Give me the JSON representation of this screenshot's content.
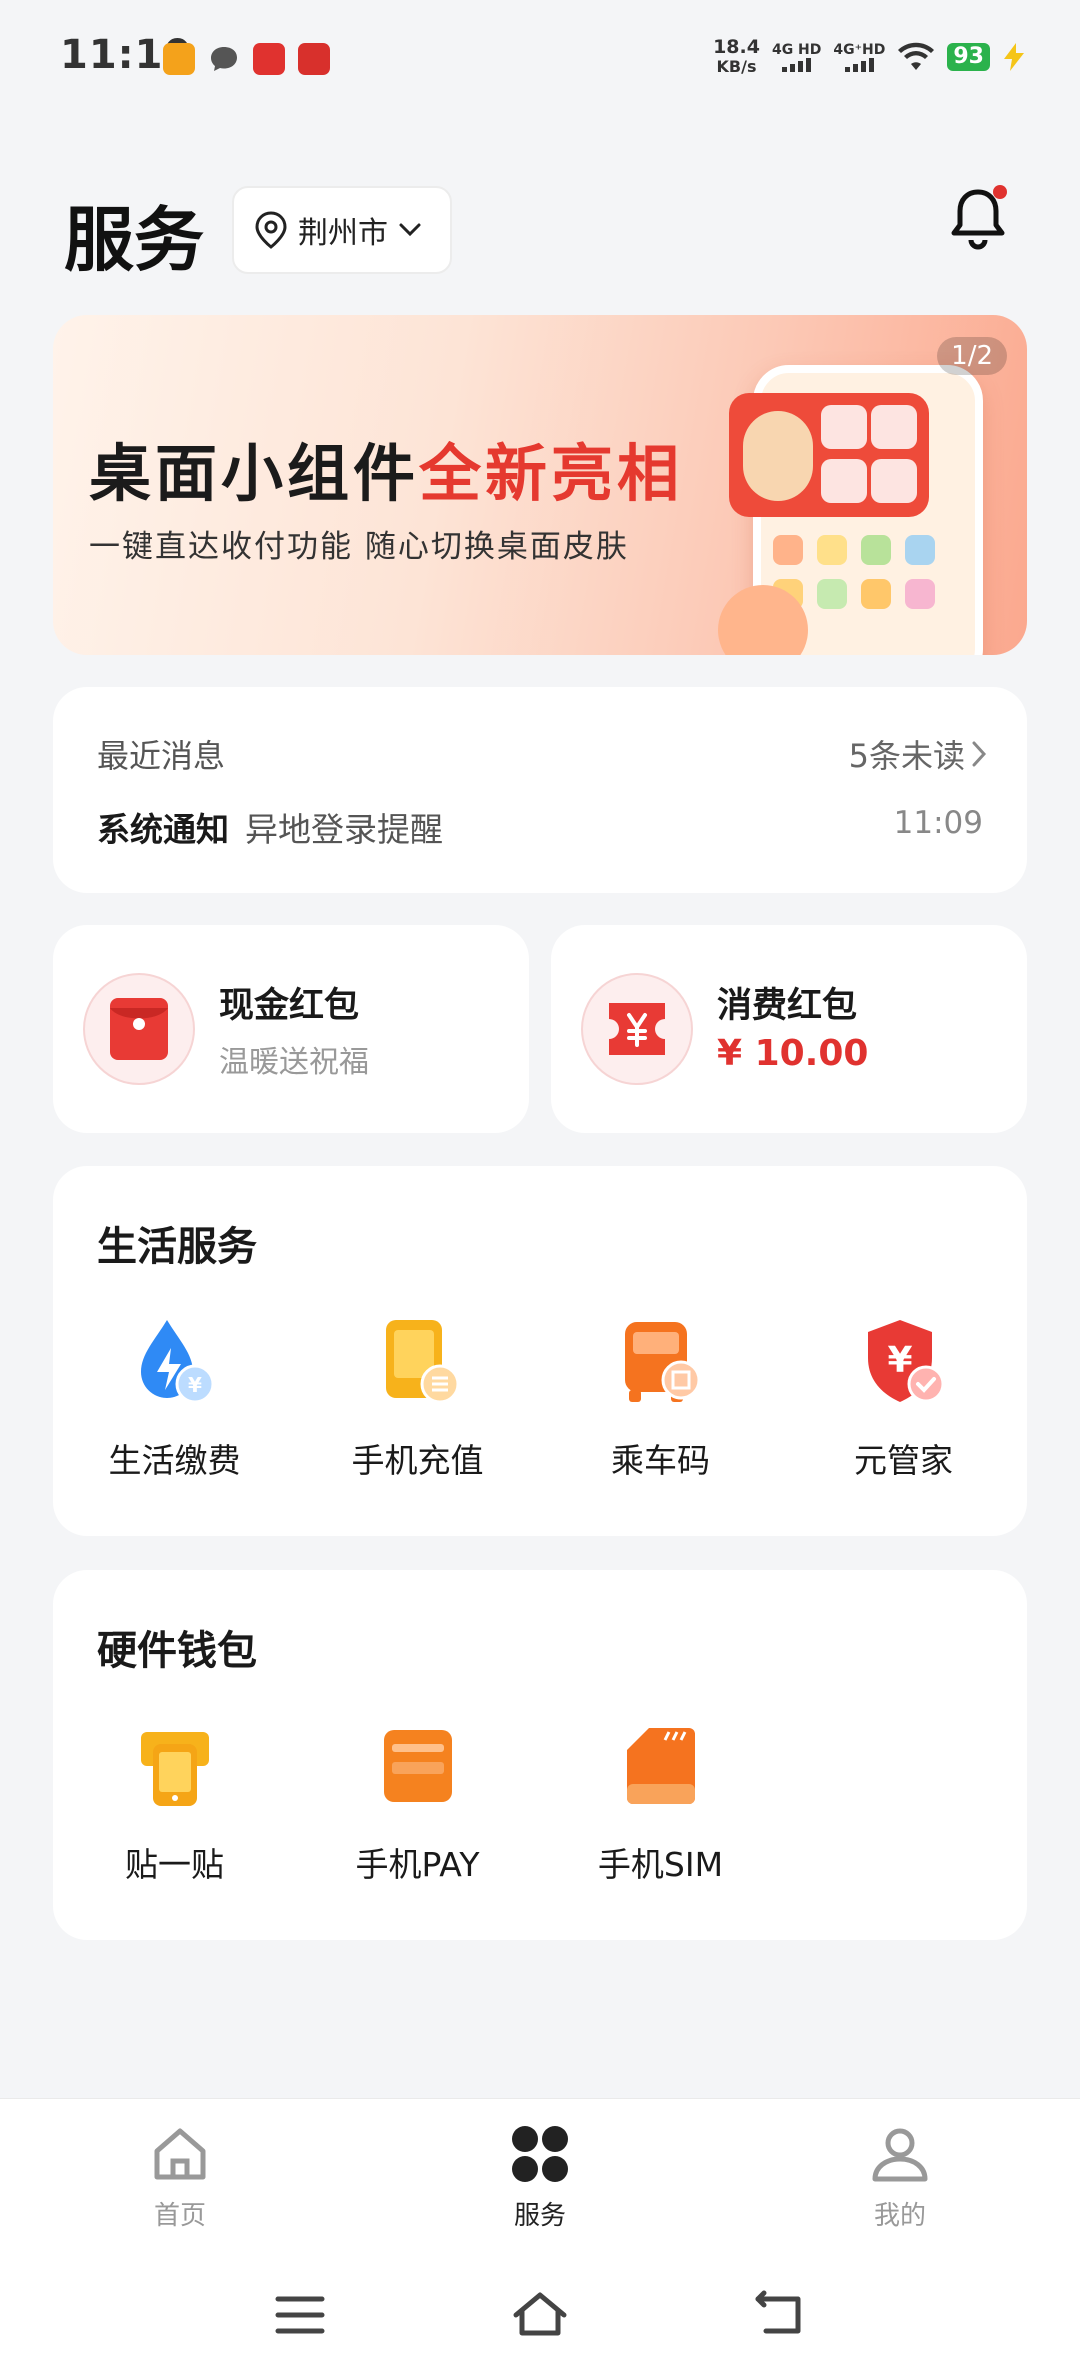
{
  "status": {
    "time": "11:10",
    "speed_value": "18.4",
    "speed_unit": "KB/s",
    "net1": "4G HD",
    "net2": "4G⁺HD",
    "battery": "93"
  },
  "header": {
    "title": "服务",
    "city": "荆州市"
  },
  "banner": {
    "title_part1": "桌面小组件",
    "title_part2": "全新亮相",
    "subtitle": "一键直达收付功能  随心切换桌面皮肤",
    "page_indicator": "1/2"
  },
  "messages": {
    "heading": "最近消息",
    "unread": "5条未读",
    "type": "系统通知",
    "text": "异地登录提醒",
    "time": "11:09"
  },
  "red_packets": {
    "cash": {
      "title": "现金红包",
      "subtitle": "温暖送祝福"
    },
    "consume": {
      "title": "消费红包",
      "amount": "¥ 10.00"
    }
  },
  "life_services": {
    "title": "生活服务",
    "items": [
      {
        "label": "生活缴费",
        "icon": "water-drop-lightning-icon"
      },
      {
        "label": "手机充值",
        "icon": "phone-recharge-icon"
      },
      {
        "label": "乘车码",
        "icon": "bus-code-icon"
      },
      {
        "label": "元管家",
        "icon": "yuan-shield-icon"
      }
    ]
  },
  "hardware_wallet": {
    "title": "硬件钱包",
    "items": [
      {
        "label": "贴一贴",
        "icon": "tap-card-icon"
      },
      {
        "label": "手机PAY",
        "icon": "wallet-card-icon"
      },
      {
        "label": "手机SIM",
        "icon": "sim-card-icon"
      }
    ]
  },
  "tabs": [
    {
      "label": "首页",
      "icon": "home-icon"
    },
    {
      "label": "服务",
      "icon": "services-grid-icon"
    },
    {
      "label": "我的",
      "icon": "profile-icon"
    }
  ],
  "colors": {
    "accent_red": "#e0322f",
    "background": "#f4f5f7",
    "battery_green": "#2bb24c"
  }
}
